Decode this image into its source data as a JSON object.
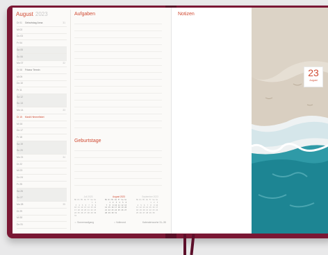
{
  "left_page": {
    "month_title": "August",
    "year": "2023",
    "days": [
      {
        "label": "Di 01",
        "event": "Geburtstag Anna",
        "kw": "31",
        "we": false,
        "hl": false
      },
      {
        "label": "Mi 02",
        "event": "",
        "kw": "",
        "we": false,
        "hl": false
      },
      {
        "label": "Do 03",
        "event": "",
        "kw": "",
        "we": false,
        "hl": false
      },
      {
        "label": "Fr 04",
        "event": "",
        "kw": "",
        "we": false,
        "hl": false
      },
      {
        "label": "Sa 05",
        "event": "",
        "kw": "",
        "we": true,
        "hl": false
      },
      {
        "label": "So 06",
        "event": "",
        "kw": "",
        "we": true,
        "hl": false
      },
      {
        "label": "Mo 07",
        "event": "",
        "kw": "32",
        "we": false,
        "hl": false
      },
      {
        "label": "Di 08",
        "event": "Friseur Termin",
        "kw": "",
        "we": false,
        "hl": false
      },
      {
        "label": "Mi 09",
        "event": "",
        "kw": "",
        "we": false,
        "hl": false
      },
      {
        "label": "Do 10",
        "event": "",
        "kw": "",
        "we": false,
        "hl": false
      },
      {
        "label": "Fr 11",
        "event": "",
        "kw": "",
        "we": false,
        "hl": false
      },
      {
        "label": "Sa 12",
        "event": "",
        "kw": "",
        "we": true,
        "hl": false
      },
      {
        "label": "So 13",
        "event": "",
        "kw": "",
        "we": true,
        "hl": false
      },
      {
        "label": "Mo 14",
        "event": "",
        "kw": "33",
        "we": false,
        "hl": false
      },
      {
        "label": "Di 15",
        "event": "Mariä Himmelfahrt",
        "kw": "",
        "we": false,
        "hl": true
      },
      {
        "label": "Mi 16",
        "event": "",
        "kw": "",
        "we": false,
        "hl": false
      },
      {
        "label": "Do 17",
        "event": "",
        "kw": "",
        "we": false,
        "hl": false
      },
      {
        "label": "Fr 18",
        "event": "",
        "kw": "",
        "we": false,
        "hl": false
      },
      {
        "label": "Sa 19",
        "event": "",
        "kw": "",
        "we": true,
        "hl": false
      },
      {
        "label": "So 20",
        "event": "",
        "kw": "",
        "we": true,
        "hl": false
      },
      {
        "label": "Mo 21",
        "event": "",
        "kw": "34",
        "we": false,
        "hl": false
      },
      {
        "label": "Di 22",
        "event": "",
        "kw": "",
        "we": false,
        "hl": false
      },
      {
        "label": "Mi 23",
        "event": "",
        "kw": "",
        "we": false,
        "hl": false
      },
      {
        "label": "Do 24",
        "event": "",
        "kw": "",
        "we": false,
        "hl": false
      },
      {
        "label": "Fr 25",
        "event": "",
        "kw": "",
        "we": false,
        "hl": false
      },
      {
        "label": "Sa 26",
        "event": "",
        "kw": "",
        "we": true,
        "hl": false
      },
      {
        "label": "So 27",
        "event": "",
        "kw": "",
        "we": true,
        "hl": false
      },
      {
        "label": "Mo 28",
        "event": "",
        "kw": "35",
        "we": false,
        "hl": false
      },
      {
        "label": "Di 29",
        "event": "",
        "kw": "",
        "we": false,
        "hl": false
      },
      {
        "label": "Mi 30",
        "event": "",
        "kw": "",
        "we": false,
        "hl": false
      },
      {
        "label": "Do 31",
        "event": "",
        "kw": "",
        "we": false,
        "hl": false
      }
    ],
    "tasks_title": "Aufgaben",
    "birthdays_title": "Geburtstage",
    "mini_calendars": [
      {
        "title": "Juli 2023",
        "rows": [
          "Mo Di Mi Do Fr Sa So",
          "                1  2",
          " 3  4  5  6  7  8  9",
          "10 11 12 13 14 15 16",
          "17 18 19 20 21 22 23",
          "24 25 26 27 28 29 30",
          "31"
        ]
      },
      {
        "title": "August 2023",
        "rows": [
          "Mo Di Mi Do Fr Sa So",
          "    1  2  3  4  5  6",
          " 7  8  9 10 11 12 13",
          "14 15 16 17 18 19 20",
          "21 22 23 24 25 26 27",
          "28 29 30 31"
        ]
      },
      {
        "title": "September 2023",
        "rows": [
          "Mo Di Mi Do Fr Sa So",
          "             1  2  3",
          " 4  5  6  7  8  9 10",
          "11 12 13 14 15 16 17",
          "18 19 20 21 22 23 24",
          "25 26 27 28 29 30"
        ]
      }
    ],
    "legend": [
      "Sonnenaufgang",
      "Vollmond"
    ],
    "footer_right": "Kalenderwoche 31–35"
  },
  "right_page": {
    "notes_title": "Notizen",
    "date_tab_number": "23",
    "date_tab_month": "August"
  }
}
